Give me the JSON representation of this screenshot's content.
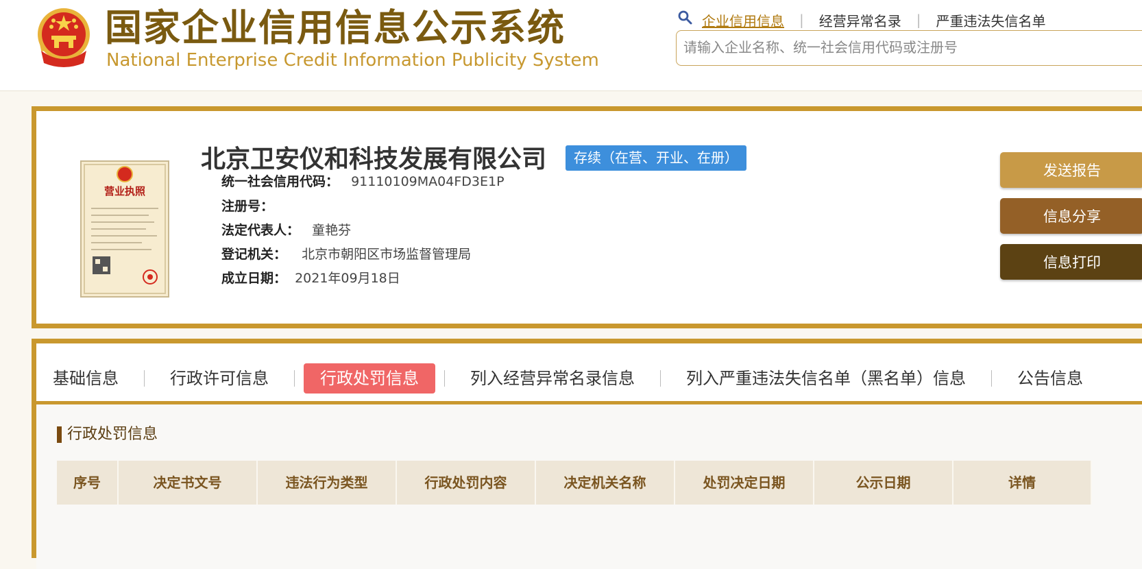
{
  "header": {
    "title_cn": "国家企业信用信息公示系统",
    "title_en": "National Enterprise Credit Information Publicity System",
    "emblem_icon": "national-emblem-icon",
    "search_icon": "magnifier-icon",
    "nav": [
      "企业信用信息",
      "经营异常名录",
      "严重违法失信名单"
    ],
    "search_placeholder": "请输入企业名称、统一社会信用代码或注册号"
  },
  "company": {
    "name": "北京卫安仪和科技发展有限公司",
    "status": "存续（在营、开业、在册）",
    "license_image_text": "营业执照",
    "fields": [
      {
        "label": "统一社会信用代码：",
        "value": "91110109MA04FD3E1P"
      },
      {
        "label": "注册号：",
        "value": ""
      },
      {
        "label": "法定代表人：",
        "value": "童艳芬"
      },
      {
        "label": "登记机关：",
        "value": "北京市朝阳区市场监督管理局"
      },
      {
        "label": "成立日期：",
        "value": "2021年09月18日"
      }
    ],
    "buttons": [
      "发送报告",
      "信息分享",
      "信息打印"
    ]
  },
  "tabs": [
    "基础信息",
    "行政许可信息",
    "行政处罚信息",
    "列入经营异常名录信息",
    "列入严重违法失信名单（黑名单）信息",
    "公告信息"
  ],
  "active_tab": "行政处罚信息",
  "section": {
    "title": "行政处罚信息",
    "columns": [
      "序号",
      "决定书文号",
      "违法行为类型",
      "行政处罚内容",
      "决定机关名称",
      "处罚决定日期",
      "公示日期",
      "详情"
    ]
  },
  "colors": {
    "brand_gold": "#c9982e",
    "title_brown": "#7a5a10",
    "status_blue": "#3d8fdc",
    "active_tab_red": "#f06666",
    "btn_send": "#c89a47",
    "btn_share": "#946027",
    "btn_print": "#5c4213"
  }
}
